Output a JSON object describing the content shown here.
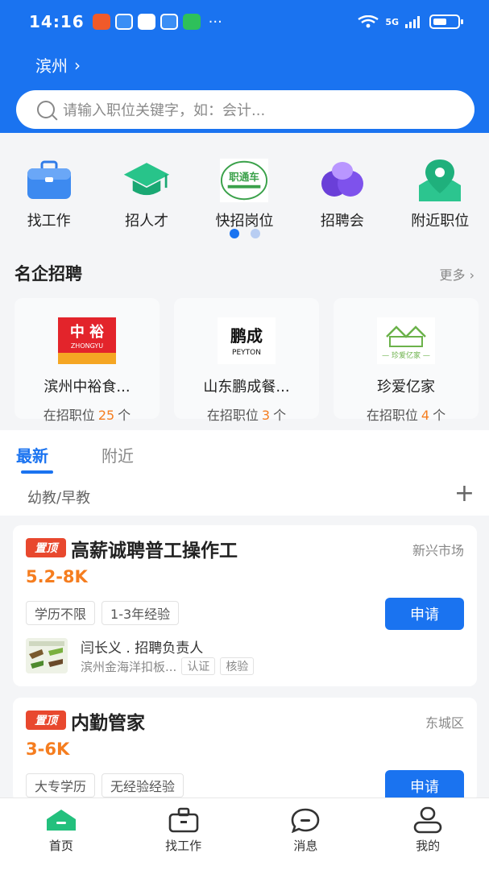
{
  "status": {
    "time": "14:16",
    "network": "5G"
  },
  "header": {
    "city": "滨州",
    "city_chevron": "›",
    "search_placeholder": "请输入职位关键字，如：会计..."
  },
  "categories": [
    {
      "label": "找工作",
      "icon": "briefcase-icon"
    },
    {
      "label": "招人才",
      "icon": "graduation-cap-icon"
    },
    {
      "label": "快招岗位",
      "icon": "zhitongche-logo-icon",
      "logo_text": "职通车"
    },
    {
      "label": "招聘会",
      "icon": "job-fair-icon"
    },
    {
      "label": "附近职位",
      "icon": "location-pin-icon"
    }
  ],
  "famous": {
    "title": "名企招聘",
    "more": "更多",
    "companies": [
      {
        "name": "滨州中裕食...",
        "pos_prefix": "在招职位",
        "count": "25",
        "pos_suffix": "个",
        "logo_main": "中裕",
        "logo_sub": "ZHONGYU"
      },
      {
        "name": "山东鹏成餐...",
        "pos_prefix": "在招职位",
        "count": "3",
        "pos_suffix": "个",
        "logo_main": "鹏成",
        "logo_sub": "PEYTON"
      },
      {
        "name": "珍爱亿家",
        "pos_prefix": "在招职位",
        "count": "4",
        "pos_suffix": "个",
        "logo_main": "珍爱亿家"
      }
    ]
  },
  "tabs": {
    "latest": "最新",
    "nearby": "附近",
    "filter": "幼教/早教",
    "add": "+"
  },
  "jobs": [
    {
      "badge": "置顶",
      "title": "高薪诚聘普工操作工",
      "location": "新兴市场",
      "salary": "5.2-8K",
      "tags": [
        "学历不限",
        "1-3年经验"
      ],
      "apply": "申请",
      "recruiter": "闫长义 . 招聘负责人",
      "company": "滨州金海洋扣板...",
      "badges": [
        "认证",
        "核验"
      ]
    },
    {
      "badge": "置顶",
      "title": "内勤管家",
      "location": "东城区",
      "salary": "3-6K",
      "tags": [
        "大专学历",
        "无经验经验"
      ],
      "apply": "申请"
    }
  ],
  "nav": [
    {
      "label": "首页",
      "icon": "home-icon"
    },
    {
      "label": "找工作",
      "icon": "briefcase-icon"
    },
    {
      "label": "消息",
      "icon": "message-icon"
    },
    {
      "label": "我的",
      "icon": "user-icon"
    }
  ],
  "colors": {
    "brand": "#1a73f0",
    "salary": "#f57d1f",
    "badge": "#e8482e",
    "nav_active": "#23c07d"
  }
}
